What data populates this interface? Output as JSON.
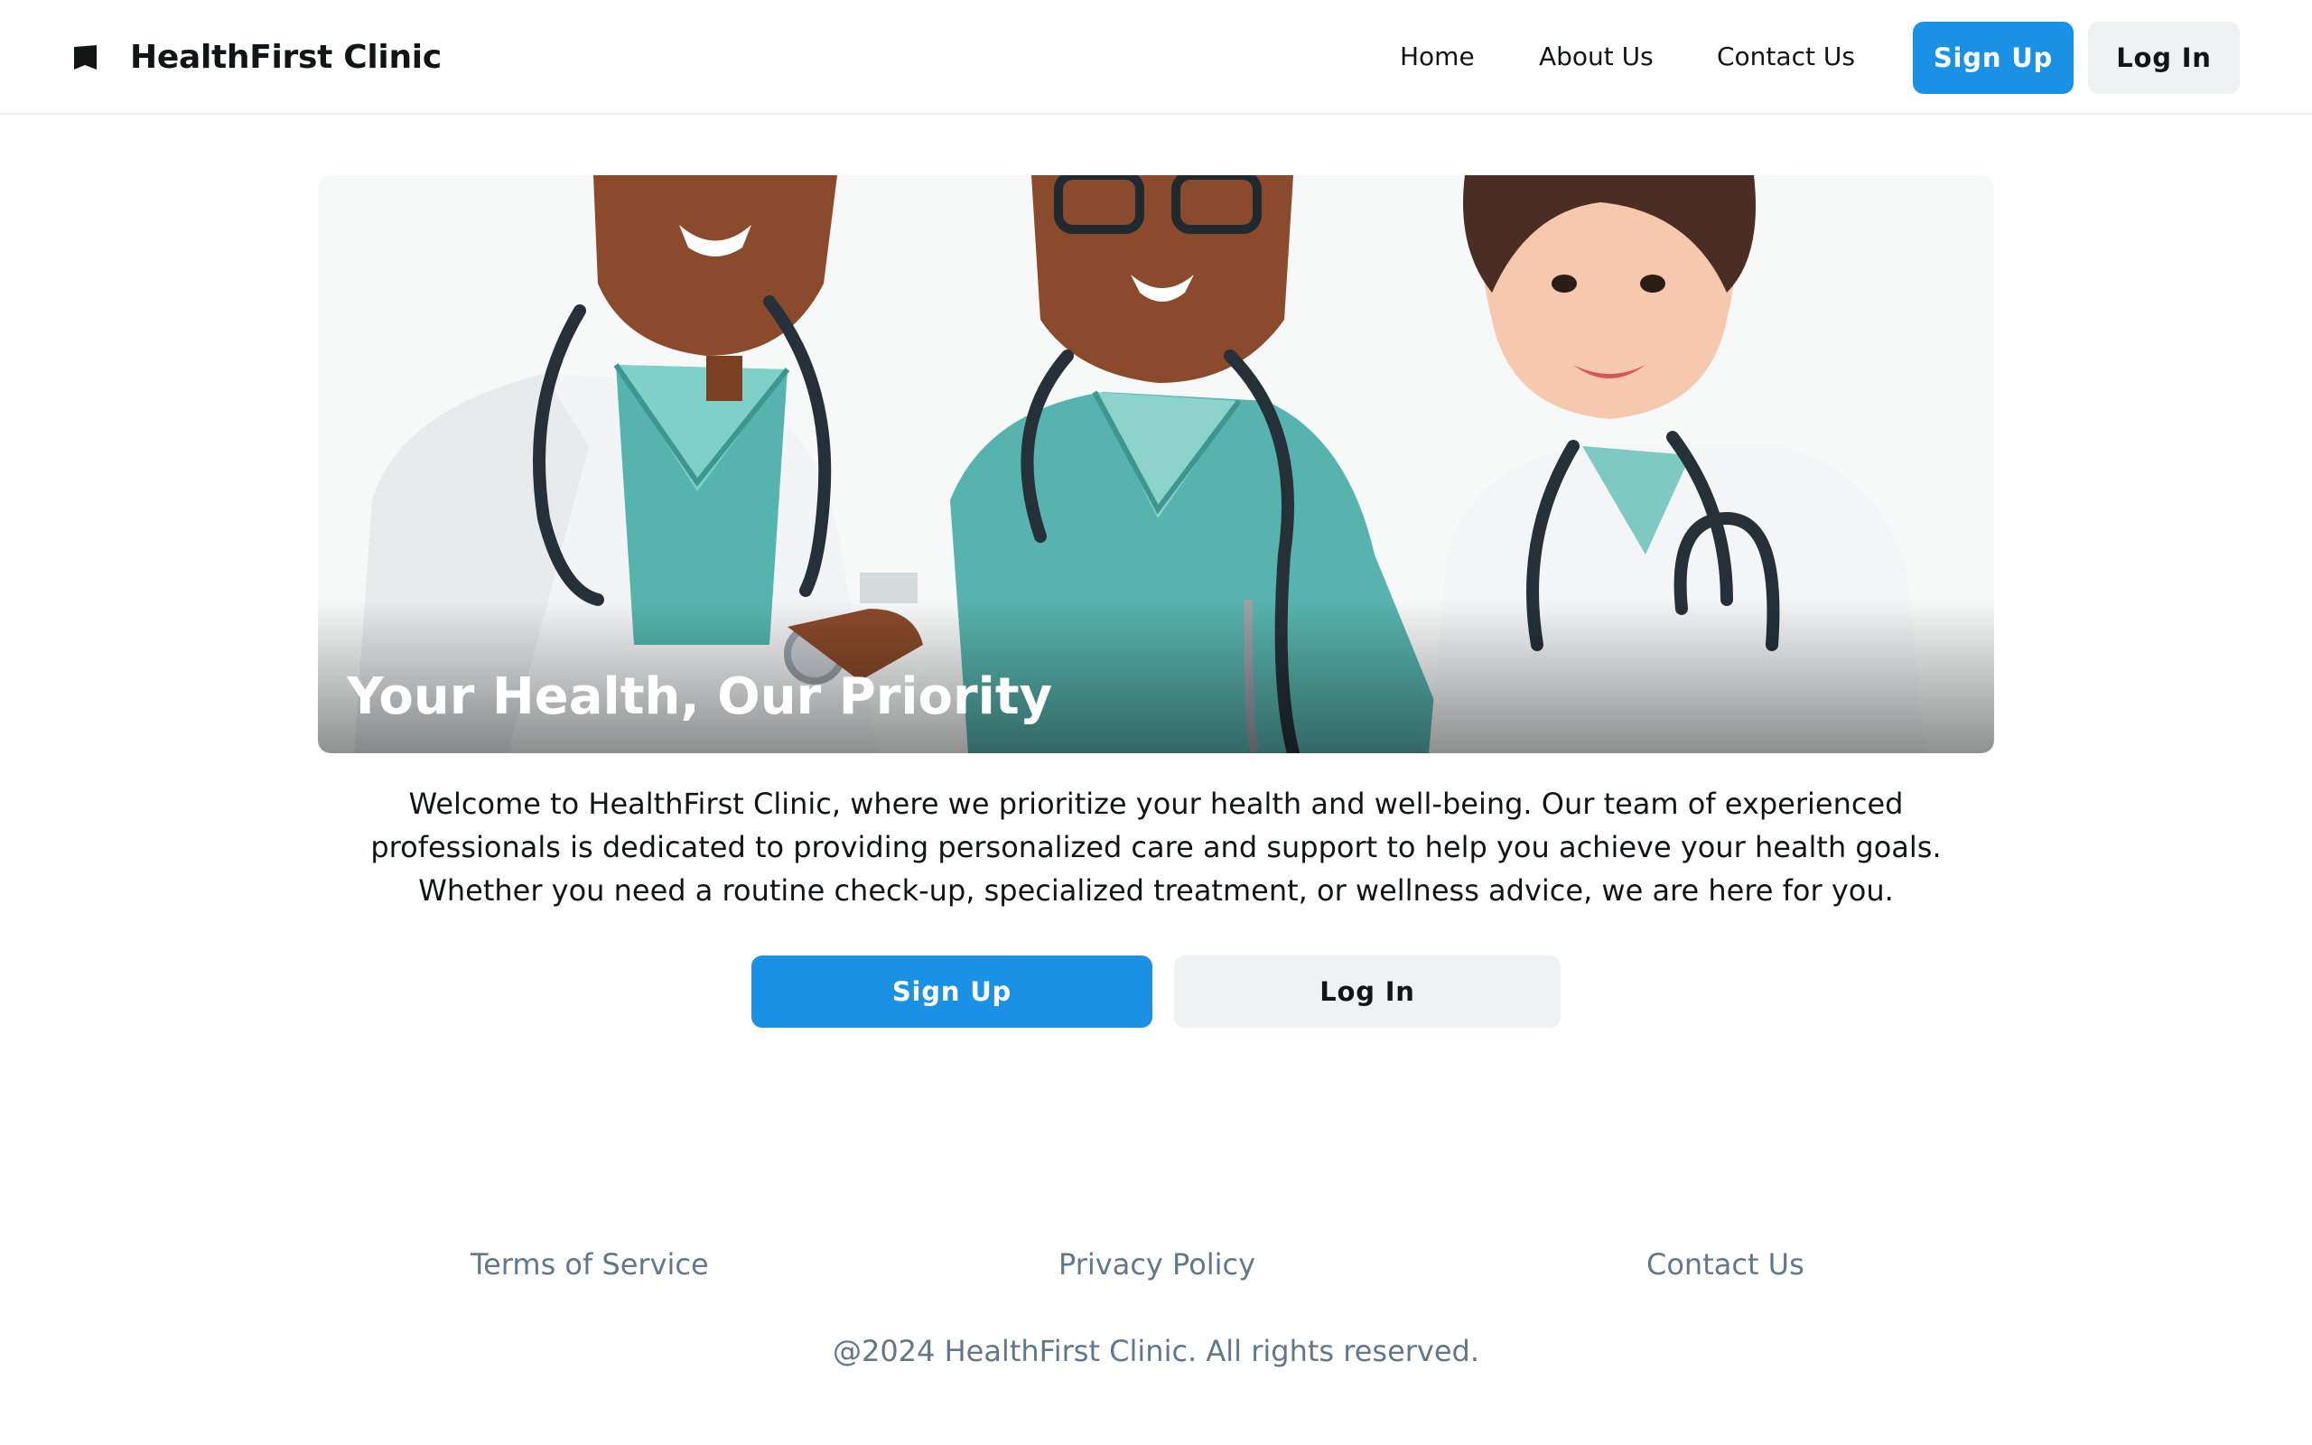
{
  "header": {
    "brand_name": "HealthFirst Clinic",
    "brand_icon": "square-logo-icon",
    "nav": {
      "home": "Home",
      "about": "About Us",
      "contact": "Contact Us"
    },
    "signup_label": "Sign Up",
    "login_label": "Log In"
  },
  "hero": {
    "title": "Your Health, Our Priority",
    "illustration": "three-doctors-with-stethoscopes"
  },
  "intro": {
    "text": "Welcome to HealthFirst Clinic, where we prioritize your health and well-being. Our team of experienced professionals is dedicated to providing personalized care and support to help you achieve your health goals. Whether you need a routine check-up, specialized treatment, or wellness advice, we are here for you.",
    "signup_label": "Sign Up",
    "login_label": "Log In"
  },
  "footer": {
    "terms": "Terms of Service",
    "privacy": "Privacy Policy",
    "contact": "Contact Us",
    "copyright": "@2024 HealthFirst Clinic. All rights reserved."
  },
  "colors": {
    "primary": "#1b91e5",
    "secondary_bg": "#eff2f3",
    "muted_text": "#60788a",
    "text": "#121416"
  }
}
